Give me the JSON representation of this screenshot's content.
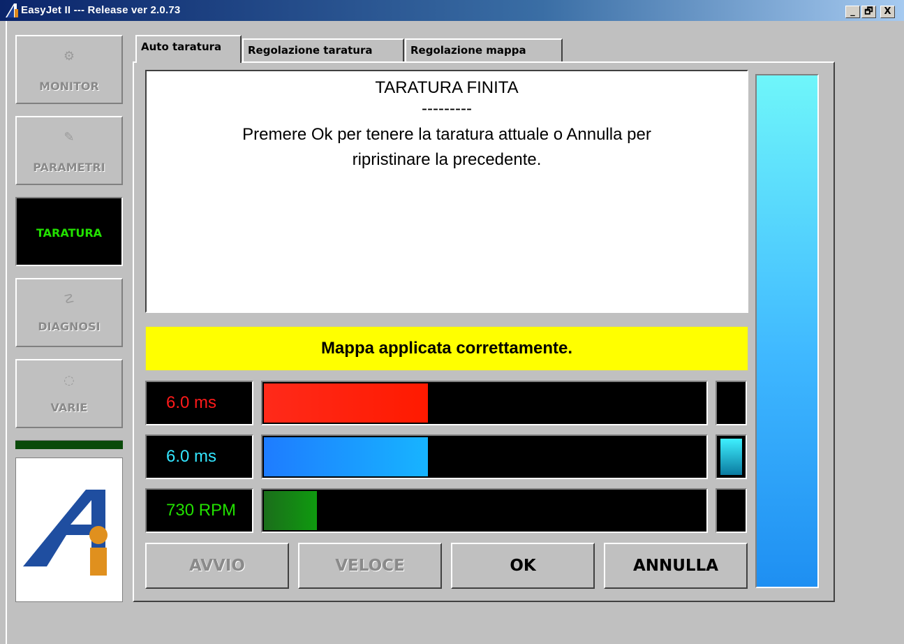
{
  "window": {
    "title": "EasyJet II --- Release ver 2.0.73",
    "controls": [
      "_",
      "🗗",
      "X"
    ]
  },
  "sidebar": {
    "items": [
      {
        "label": "MONITOR",
        "icon": "gear-icon",
        "active": false
      },
      {
        "label": "PARAMETRI",
        "icon": "wrench-icon",
        "active": false
      },
      {
        "label": "TARATURA",
        "icon": "",
        "active": true
      },
      {
        "label": "DIAGNOSI",
        "icon": "stethoscope-icon",
        "active": false
      },
      {
        "label": "VARIE",
        "icon": "globe-icon",
        "active": false
      }
    ]
  },
  "tabs": [
    {
      "label": "Auto taratura",
      "active": true
    },
    {
      "label": "Regolazione taratura",
      "active": false
    },
    {
      "label": "Regolazione mappa",
      "active": false
    }
  ],
  "message": {
    "title": "TARATURA FINITA",
    "separator": "---------",
    "line1": "Premere Ok per tenere la taratura attuale o Annulla per",
    "line2": "ripristinare la precedente."
  },
  "status": {
    "text": "Mappa applicata correttamente.",
    "color": "#ffff00"
  },
  "gauges": [
    {
      "label": "6.0 ms",
      "text_color": "#ff1a1a",
      "fill_fraction": 0.37,
      "fill_colors": [
        "#ff2a1a",
        "#ff1a00"
      ],
      "indicator_on": false
    },
    {
      "label": "6.0 ms",
      "text_color": "#33e6ff",
      "fill_fraction": 0.37,
      "fill_colors": [
        "#1e7cff",
        "#17b4ff"
      ],
      "indicator_on": true
    },
    {
      "label": "730 RPM",
      "text_color": "#22e000",
      "fill_fraction": 0.12,
      "fill_colors": [
        "#1b6e1b",
        "#0f9a0f"
      ],
      "indicator_on": false
    }
  ],
  "buttons": [
    {
      "label": "AVVIO",
      "enabled": false
    },
    {
      "label": "VELOCE",
      "enabled": false
    },
    {
      "label": "OK",
      "enabled": true
    },
    {
      "label": "ANNULLA",
      "enabled": true
    }
  ],
  "level_gauge": {
    "fill_fraction": 1.0
  }
}
